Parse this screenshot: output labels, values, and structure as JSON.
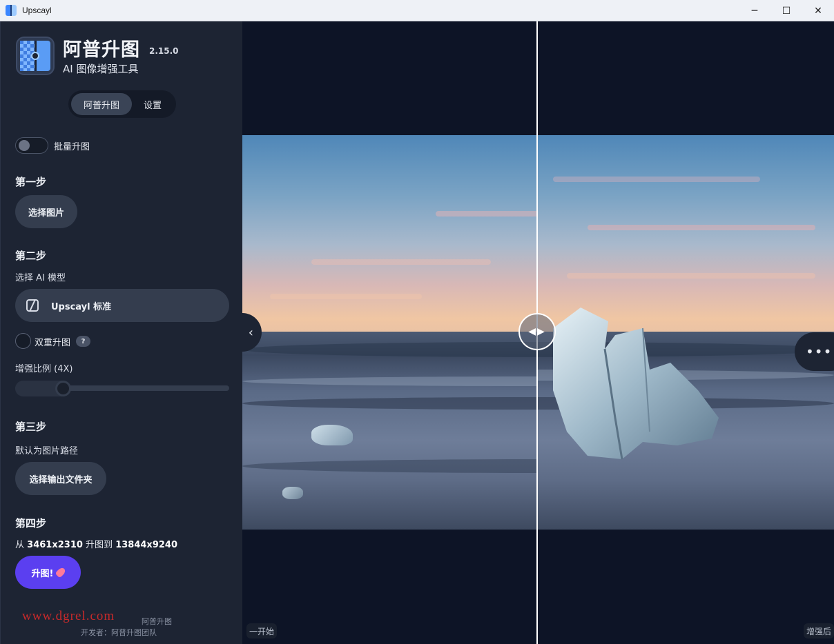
{
  "window": {
    "title": "Upscayl",
    "minimize_glyph": "─",
    "maximize_glyph": "☐",
    "close_glyph": "✕"
  },
  "app": {
    "name": "阿普升图",
    "version": "2.15.0",
    "subtitle": "AI 图像增强工具"
  },
  "tabs": [
    {
      "label": "阿普升图",
      "active": true
    },
    {
      "label": "设置",
      "active": false
    }
  ],
  "batch": {
    "label": "批量升图",
    "enabled": false
  },
  "step1": {
    "heading": "第一步",
    "button": "选择图片"
  },
  "step2": {
    "heading": "第二步",
    "sub": "选择 AI 模型",
    "model": "Upscayl 标准",
    "double_label": "双重升图",
    "help": "?",
    "scale_label": "增强比例 (4X)",
    "scale_value": 4
  },
  "step3": {
    "heading": "第三步",
    "sub": "默认为图片路径",
    "button": "选择输出文件夹"
  },
  "step4": {
    "heading": "第四步",
    "prefix": "从",
    "from": "3461x2310",
    "middle": "升图到",
    "to": "13844x9240",
    "button": "升图!"
  },
  "footer": {
    "line1": "阿普升图",
    "line2": "开发者：阿普升图团队"
  },
  "watermark": "www.dgrel.com",
  "compare": {
    "before_label": "一开始",
    "after_label": "增强后",
    "handle_glyph": "◀▶",
    "collapse_glyph": "‹",
    "more_glyph": "•••"
  },
  "colors": {
    "accent": "#5b3ff0",
    "sidebar_bg": "#1d2433",
    "main_bg": "#0d1426"
  },
  "icons": {
    "model": "model-icon",
    "rocket": "rocket-icon"
  }
}
